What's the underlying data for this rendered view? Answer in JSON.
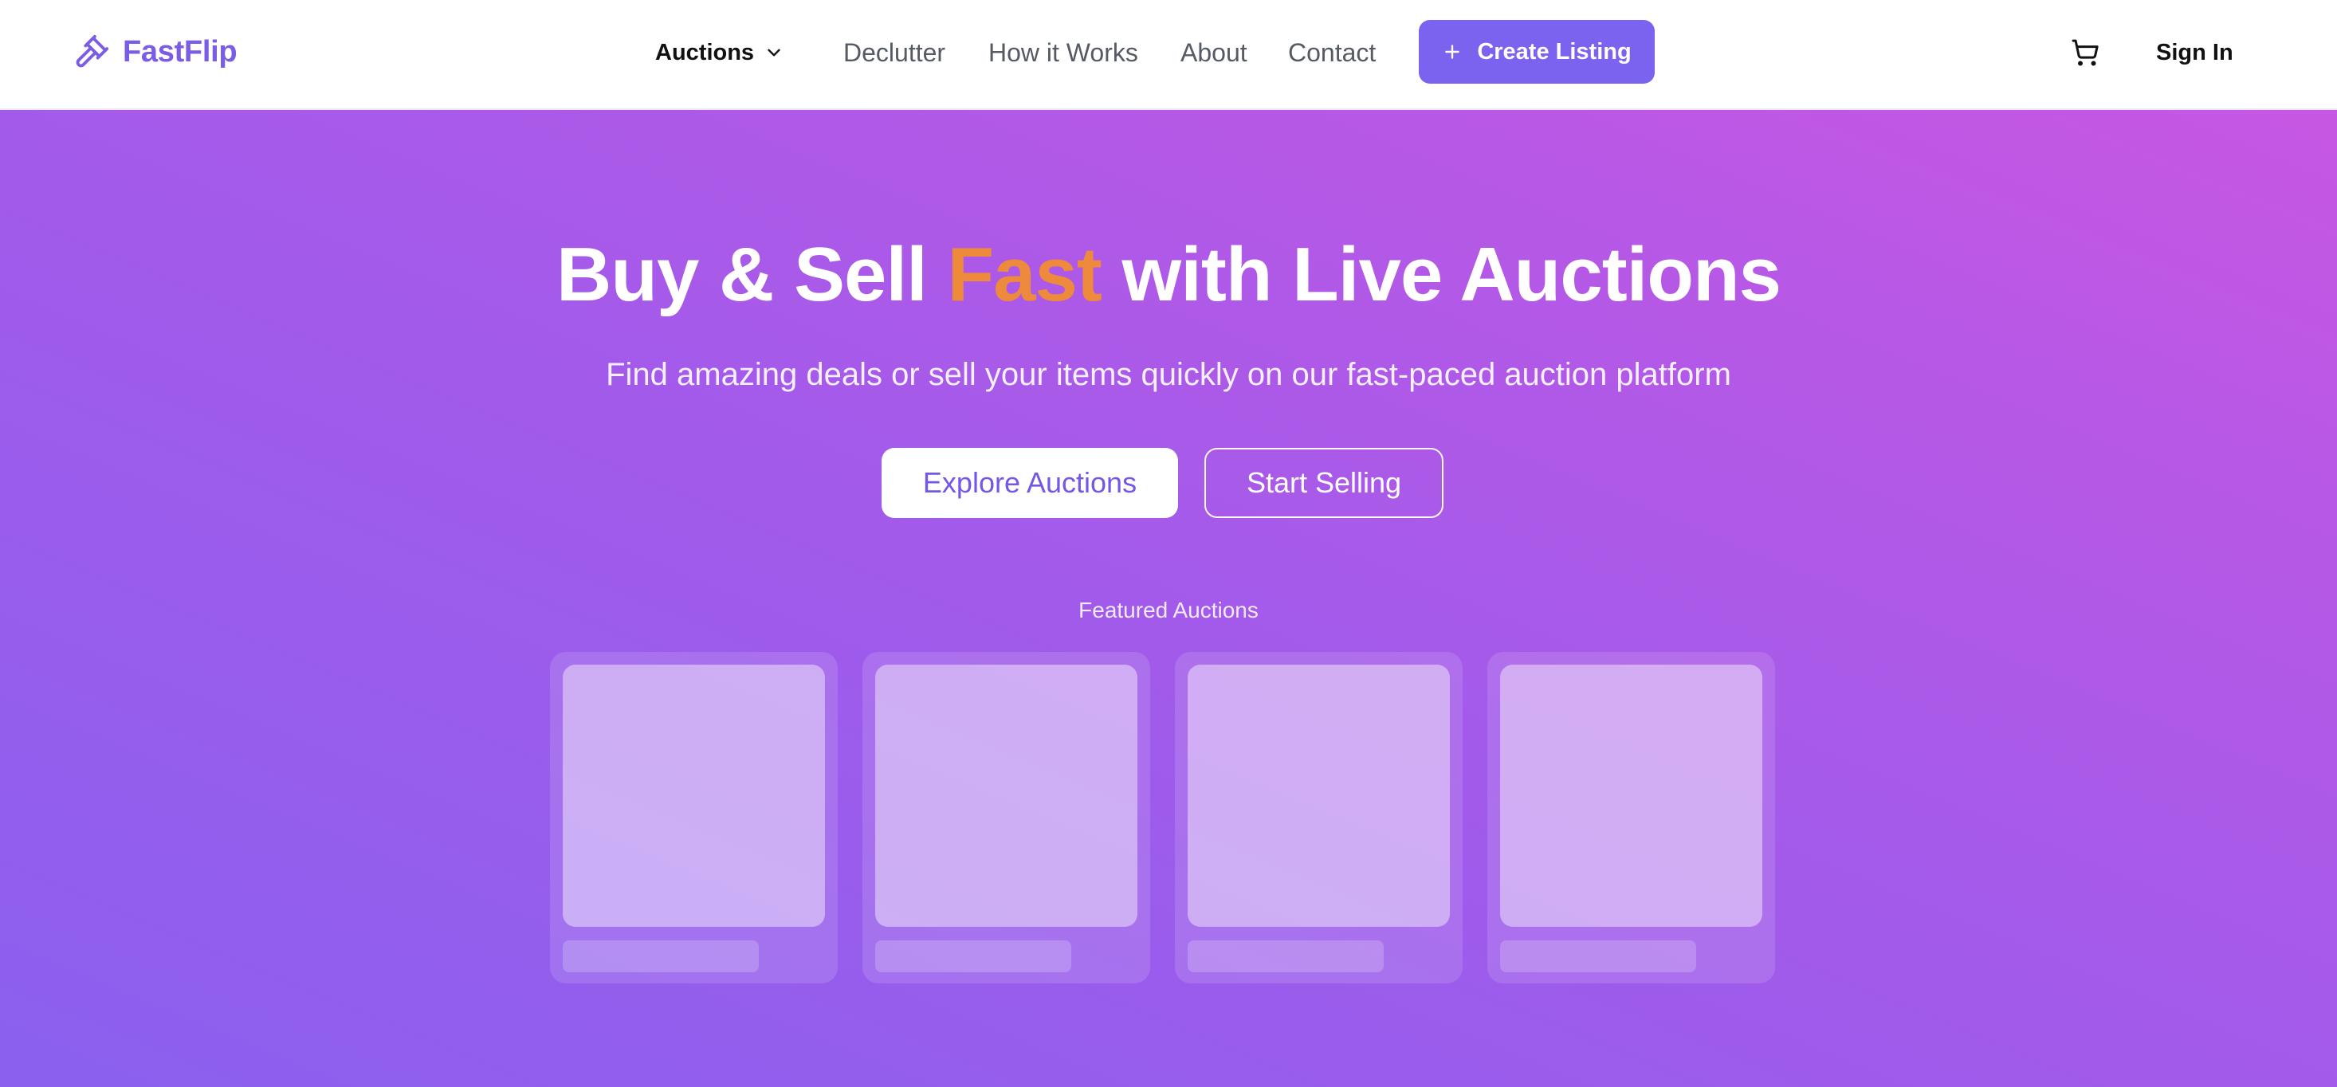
{
  "brand": {
    "name": "FastFlip",
    "color": "#7b5ce6",
    "icon": "gavel-icon"
  },
  "nav": {
    "dropdown": {
      "label": "Auctions",
      "icon": "chevron-down-icon"
    },
    "links": [
      "Declutter",
      "How it Works",
      "About",
      "Contact"
    ],
    "create_listing": {
      "label": "Create Listing",
      "icon": "plus-icon",
      "color": "#7b63ef"
    },
    "cart_icon": "cart-icon",
    "sign_in": "Sign In"
  },
  "hero": {
    "headline_before": "Buy & Sell ",
    "headline_accent": "Fast",
    "headline_after": " with Live Auctions",
    "accent_color": "#ee8a3b",
    "subtitle": "Find amazing deals or sell your items quickly on our fast-paced auction platform",
    "primary_cta": "Explore Auctions",
    "secondary_cta": "Start Selling",
    "featured_label": "Featured Auctions",
    "featured_cards_loading": 4
  },
  "colors": {
    "gradient_start": "#8b60ef",
    "gradient_mid": "#a35aea",
    "gradient_end": "#c657e3"
  }
}
